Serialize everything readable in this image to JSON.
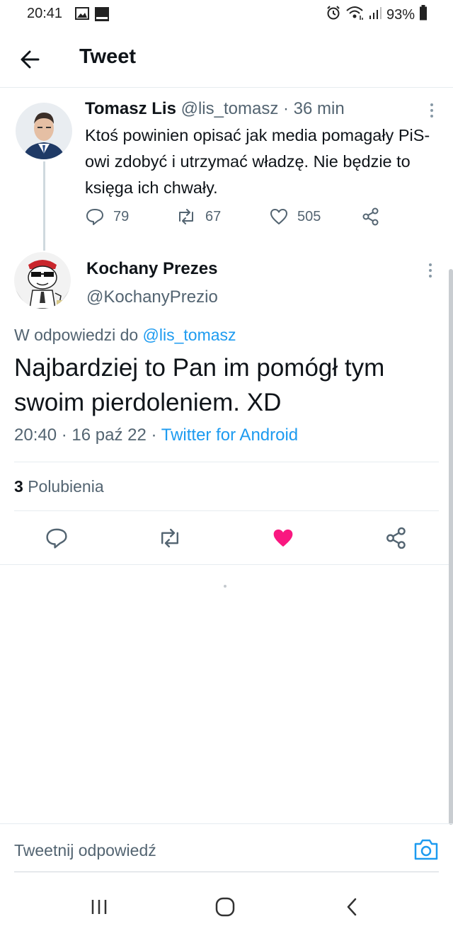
{
  "status_bar": {
    "time": "20:41",
    "battery": "93%",
    "icons": [
      "gallery-icon",
      "orange-carrier-icon",
      "alarm-icon",
      "wifi-icon",
      "signal-icon",
      "battery-icon"
    ]
  },
  "header": {
    "title": "Tweet"
  },
  "parent_tweet": {
    "name": "Tomasz Lis",
    "handle": "@lis_tomasz",
    "separator": "·",
    "time": "36 min",
    "text": "Ktoś powinien opisać jak media pomagały PiS-owi zdobyć i utrzymać władzę. Nie będzie to księga ich chwały.",
    "replies": "79",
    "retweets": "67",
    "likes": "505"
  },
  "main_tweet": {
    "name": "Kochany Prezes",
    "handle": "@KochanyPrezio",
    "reply_prefix": "W odpowiedzi do",
    "reply_to": "@lis_tomasz",
    "text": "Najbardziej to Pan im pomógł tym swoim pierdoleniem. XD",
    "time": "20:40",
    "date": "16 paź 22",
    "separator": "·",
    "source": "Twitter for Android",
    "likes_count": "3",
    "likes_label": "Polubienia"
  },
  "composer": {
    "placeholder": "Tweetnij odpowiedź"
  },
  "colors": {
    "accent": "#1d9bf0",
    "like_active": "#f91880",
    "text_secondary": "#536471"
  }
}
